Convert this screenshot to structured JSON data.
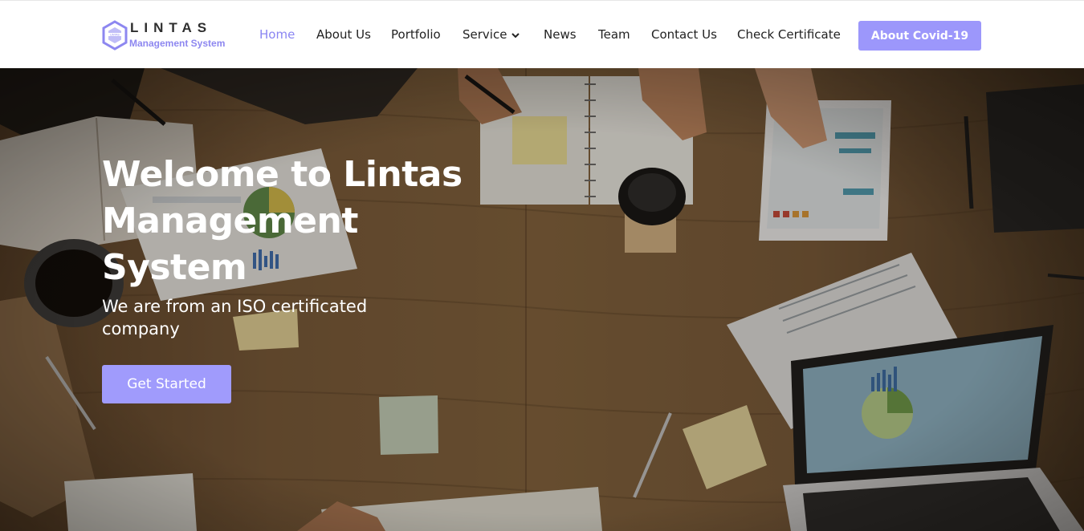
{
  "header": {
    "logo": {
      "wordmark": "LINTAS",
      "tagline": "Management System"
    },
    "nav": [
      {
        "label": "Home",
        "active": true
      },
      {
        "label": "About Us"
      },
      {
        "label": "Portfolio"
      },
      {
        "label": "Service",
        "has_dropdown": true
      },
      {
        "label": "News"
      },
      {
        "label": "Team"
      },
      {
        "label": "Contact Us"
      },
      {
        "label": "Check Certificate"
      }
    ],
    "cta_label": "About Covid-19"
  },
  "hero": {
    "title": "Welcome to Lintas Management System",
    "subtitle": "We are from an ISO certificated company",
    "button_label": "Get Started"
  },
  "colors": {
    "accent": "#9c97fb",
    "active_nav": "#8a85f2",
    "text_dark": "#222222"
  }
}
